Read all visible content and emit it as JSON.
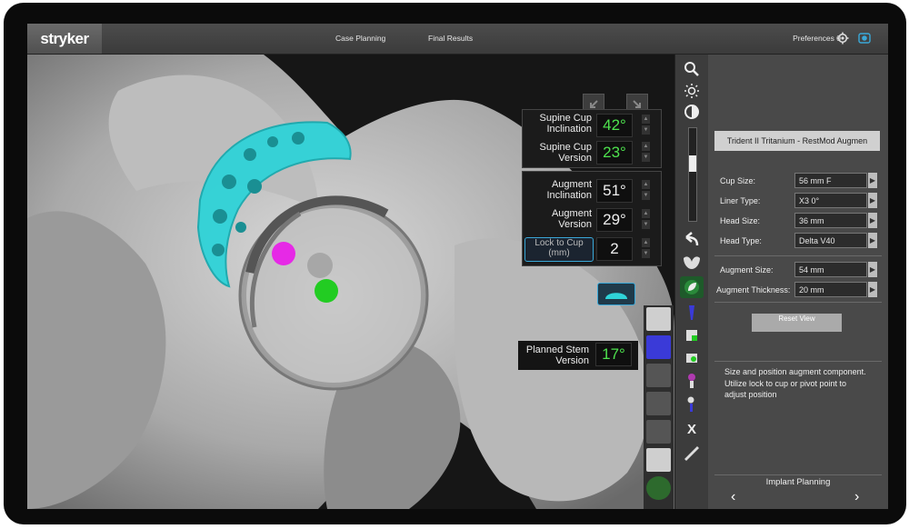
{
  "app": {
    "logo": "stryker",
    "nav": [
      "Case Planning",
      "Final Results"
    ],
    "preferences_label": "Preferences 0"
  },
  "readouts": {
    "supine_cup_inclination": {
      "label": "Supine Cup Inclination",
      "value": "42°"
    },
    "supine_cup_version": {
      "label": "Supine Cup Version",
      "value": "23°"
    },
    "augment_inclination": {
      "label": "Augment Inclination",
      "value": "51°"
    },
    "augment_version": {
      "label": "Augment Version",
      "value": "29°"
    },
    "lock_to_cup": {
      "label": "Lock to Cup (mm)",
      "value": "2"
    },
    "planned_stem_version": {
      "label": "Planned Stem Version",
      "value": "17°"
    }
  },
  "toolbar": {
    "icons": [
      "zoom-icon",
      "brightness-icon",
      "contrast-icon",
      "undo-icon",
      "pelvis-icon",
      "augment-icon",
      "stem-icon",
      "cup-icon",
      "bone-icon",
      "head-icon",
      "combined-icon",
      "x-ray-icon",
      "ruler-icon"
    ],
    "xray_label": "X"
  },
  "panel": {
    "implant_title": "Trident II Tritanium - RestMod Augmen",
    "fields": [
      {
        "label": "Cup Size:",
        "value": "56 mm F"
      },
      {
        "label": "Liner Type:",
        "value": "X3 0°"
      },
      {
        "label": "Head Size:",
        "value": "36 mm"
      },
      {
        "label": "Head Type:",
        "value": "Delta V40"
      }
    ],
    "augment_fields": [
      {
        "label": "Augment Size:",
        "value": "54 mm"
      },
      {
        "label": "Augment Thickness:",
        "value": "20 mm"
      }
    ],
    "reset_label": "Reset View",
    "instructions": "Size and position augment component. Utilize lock to cup or pivot point to adjust position",
    "footer_label": "Implant Planning"
  },
  "colors": {
    "value_green": "#4ee24e",
    "augment_cyan": "#2fd3d8",
    "pivot_magenta": "#e629e6",
    "pivot_green": "#22cc22",
    "accent_blue": "#3aa8d8"
  }
}
